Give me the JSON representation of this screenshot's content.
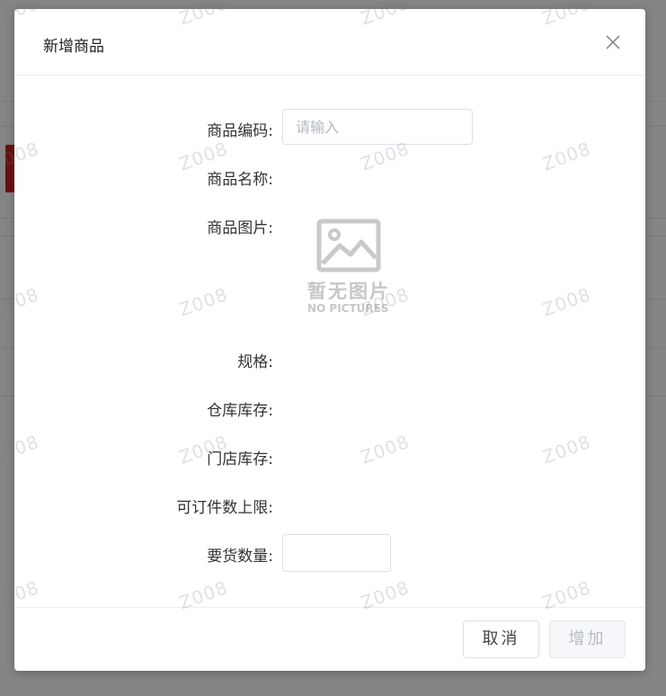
{
  "dialog": {
    "title": "新增商品",
    "close_icon": "close-icon"
  },
  "form": {
    "product_code": {
      "label": "商品编码:",
      "placeholder": "请输入",
      "value": ""
    },
    "product_name": {
      "label": "商品名称:",
      "value": ""
    },
    "product_image": {
      "label": "商品图片:",
      "placeholder_icon": "image-placeholder-icon",
      "placeholder_text_cn": "暂无图片",
      "placeholder_text_en": "NO PICTURES"
    },
    "spec": {
      "label": "规格:",
      "value": ""
    },
    "warehouse_stock": {
      "label": "仓库库存:",
      "value": ""
    },
    "store_stock": {
      "label": "门店库存:",
      "value": ""
    },
    "order_limit": {
      "label": "可订件数上限:",
      "value": ""
    },
    "request_qty": {
      "label": "要货数量:",
      "value": ""
    }
  },
  "footer": {
    "cancel_label": "取消",
    "add_label": "增加"
  },
  "watermark": {
    "text": "Z008"
  },
  "colors": {
    "overlay": "#000000",
    "accent_chip": "#c0201d",
    "border": "#dcdfe6",
    "placeholder": "#b5b8bf"
  }
}
